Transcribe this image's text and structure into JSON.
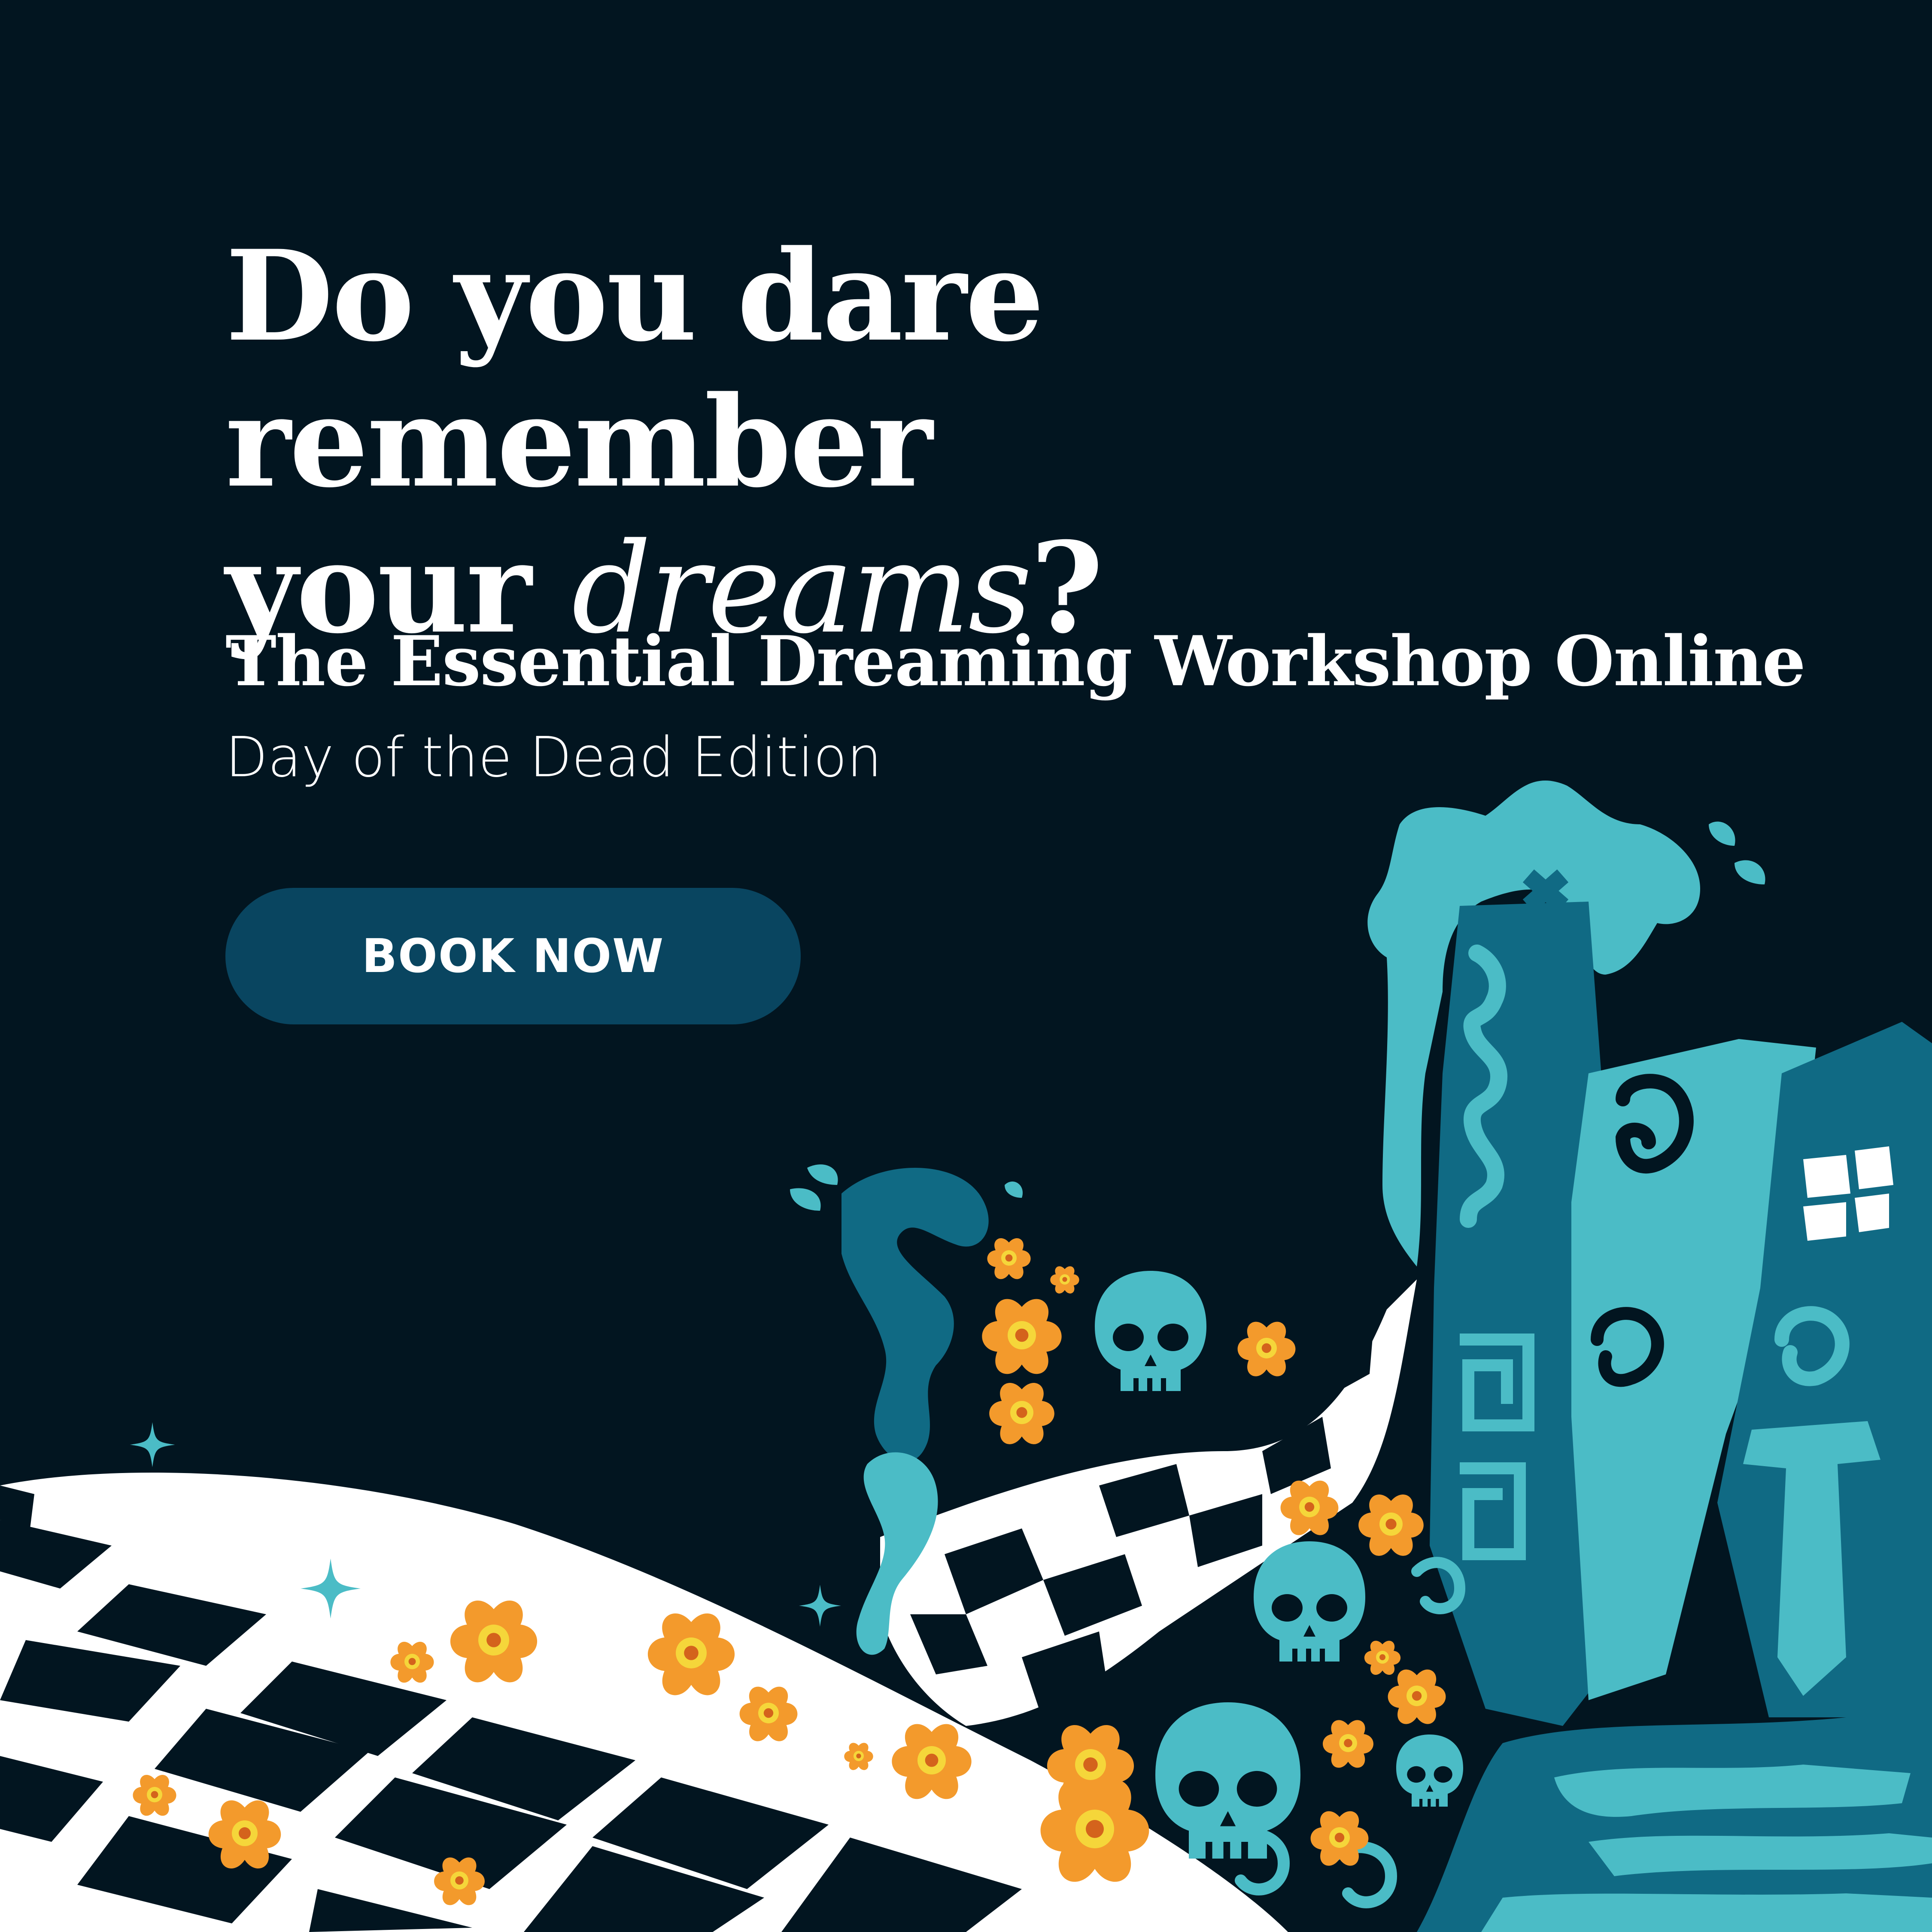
{
  "headline": {
    "line1": "Do you dare remember",
    "line2_prefix": "your ",
    "line2_emphasis": "dreams",
    "line2_suffix": "?"
  },
  "subtitle": "The Essential Dreaming Workshop Online",
  "edition": "Day of the Dead Edition",
  "cta": {
    "label": "BOOK NOW"
  },
  "colors": {
    "background": "#021520",
    "button": "#094560",
    "teal_light": "#4bbcc6",
    "teal_dark": "#106a84",
    "marigold": "#f39a2c",
    "white": "#ffffff"
  },
  "illustration": {
    "icons": [
      "skull-icon",
      "marigold-flower-icon",
      "sparkle-icon",
      "checkered-floor",
      "spiral-house"
    ]
  }
}
